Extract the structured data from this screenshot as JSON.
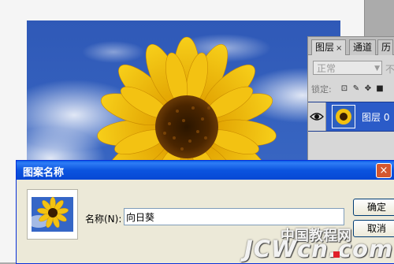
{
  "layers_panel": {
    "tabs": [
      {
        "label": "图层",
        "close": "×"
      },
      {
        "label": "通道"
      },
      {
        "label": "历"
      }
    ],
    "blend_mode": "正常",
    "opacity_label": "不",
    "lock_label": "锁定:",
    "layer": {
      "name": "图层 0"
    }
  },
  "dialog": {
    "title": "图案名称",
    "name_label": "名称(N):",
    "name_value": "向日葵",
    "ok_label": "确定",
    "cancel_label": "取消",
    "close_label": "×"
  },
  "watermark": {
    "cn": "中国教程网",
    "en": "JCWcn.com"
  }
}
